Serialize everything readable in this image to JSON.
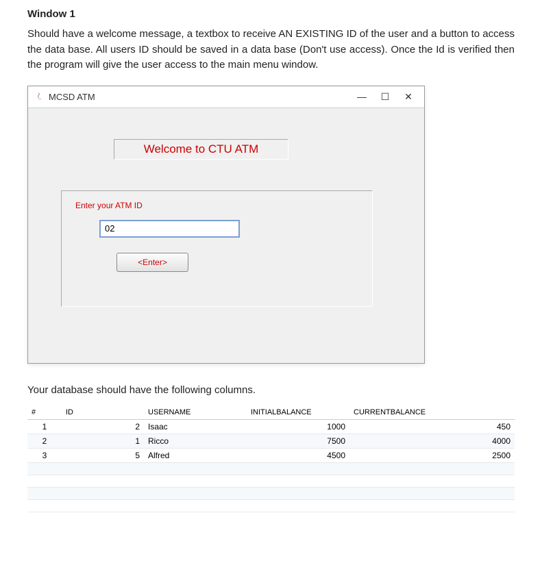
{
  "header": {
    "title": "Window 1",
    "description": "Should have a welcome message, a textbox to receive AN EXISTING ID of the user and a button to access the data base. All users ID should be saved in a data base (Don't use access). Once the Id is verified then the program will give the user access to the main menu window."
  },
  "window": {
    "title": "MCSD ATM",
    "welcome": "Welcome to CTU ATM",
    "input_label": "Enter your ATM ID",
    "input_value": "02",
    "enter_button": "<Enter>",
    "controls": {
      "minimize": "—",
      "maximize": "☐",
      "close": "✕"
    }
  },
  "database": {
    "description": "Your database should have the following columns.",
    "columns": {
      "hash": "#",
      "id": "ID",
      "username": "USERNAME",
      "initial": "INITIALBALANCE",
      "current": "CURRENTBALANCE"
    },
    "rows": [
      {
        "num": "1",
        "id": "2",
        "username": "Isaac",
        "initial": "1000",
        "current": "450"
      },
      {
        "num": "2",
        "id": "1",
        "username": "Ricco",
        "initial": "7500",
        "current": "4000"
      },
      {
        "num": "3",
        "id": "5",
        "username": "Alfred",
        "initial": "4500",
        "current": "2500"
      }
    ]
  }
}
